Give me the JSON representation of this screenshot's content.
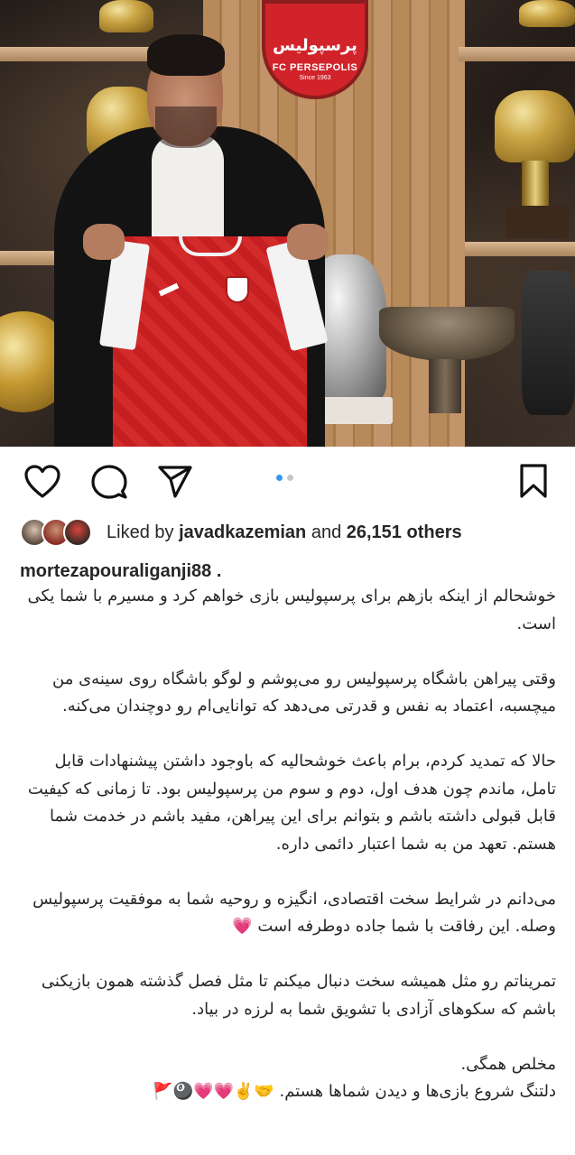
{
  "post": {
    "crest_fa": "پرسپولیس",
    "crest_en": "FC PERSEPOLIS",
    "crest_since": "Since 1963",
    "carousel": {
      "count": 2,
      "active": 1
    }
  },
  "actions": {
    "like_icon": "heart-outline-icon",
    "comment_icon": "comment-bubble-icon",
    "share_icon": "paper-plane-icon",
    "save_icon": "bookmark-outline-icon"
  },
  "likes": {
    "prefix": "Liked by ",
    "user": "javadkazemian",
    "middle": " and ",
    "count": "26,151 others"
  },
  "author": {
    "username": "mortezapouraliganji88 ."
  },
  "caption": {
    "p1": "خوشحالم از اینکه بازهم برای پرسپولیس بازی خواهم کرد و مسیرم با شما یکی است.",
    "p2": "وقتی پیراهن باشگاه پرسپولیس رو می‌پوشم و لوگو باشگاه روی سینه‌ی من میچسبه، اعتماد به نفس و قدرتی می‌دهد که توانایی‌ام رو دوچندان می‌کنه.",
    "p3": "حالا که تمدید کردم، برام باعث خوشحالیه که باوجود داشتن پیشنهادات قابل تامل، ماندم چون هدف اول، دوم و سوم من پرسپولیس بود. تا زمانی که کیفیت قابل قبولی داشته باشم و بتوانم برای این پیراهن، مفید باشم در خدمت شما هستم. تعهد من به شما اعتبار دائمی داره.",
    "p4": "می‌دانم در شرایط سخت اقتصادی، انگیزه و روحیه شما به موفقیت پرسپولیس وصله. این رفاقت با شما جاده دوطرفه است 💗",
    "p5": "تمریناتم رو مثل همیشه سخت دنبال میکنم تا مثل فصل گذشته همون بازیکنی باشم که سکوهای آزادی با تشویق شما به لرزه در بیاد.",
    "p6_line1": "مخلص همگی.",
    "p6_line2": "دلتنگ شروع بازی‌ها و دیدن شماها هستم. 🤝✌️💗💗🎱🚩"
  }
}
